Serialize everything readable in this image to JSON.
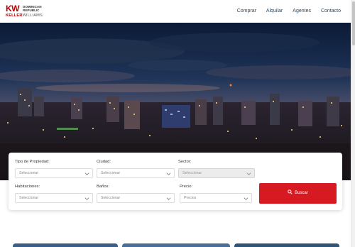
{
  "logo": {
    "kw": "KW",
    "region_line1": "DOMINICAN",
    "region_line2": "REPUBLIC",
    "brand_bold": "KELLER",
    "brand_light": "WILLIAMS."
  },
  "nav": {
    "items": [
      "Comprar",
      "Alquilar",
      "Agentes",
      "Contacto"
    ]
  },
  "search": {
    "fields": [
      {
        "label": "Tipo de Propiedad:",
        "value": "Seleccionar",
        "disabled": false
      },
      {
        "label": "Ciudad:",
        "value": "Seleccionar",
        "disabled": false
      },
      {
        "label": "Sector:",
        "value": "Seleccionar",
        "disabled": true
      },
      {
        "label": "Habitaciones:",
        "value": "Seleccionar",
        "disabled": false
      },
      {
        "label": "Baños:",
        "value": "Seleccionar",
        "disabled": false
      },
      {
        "label": "Precio:",
        "value": "Precios",
        "disabled": false
      }
    ],
    "button_label": "Buscar"
  },
  "colors": {
    "brand_red": "#d71921",
    "logo_red": "#b40101",
    "nav_text": "#2c4a63",
    "hero_sky": "#0d1b33"
  },
  "icons": [
    "chevron-down-icon",
    "search-icon"
  ]
}
